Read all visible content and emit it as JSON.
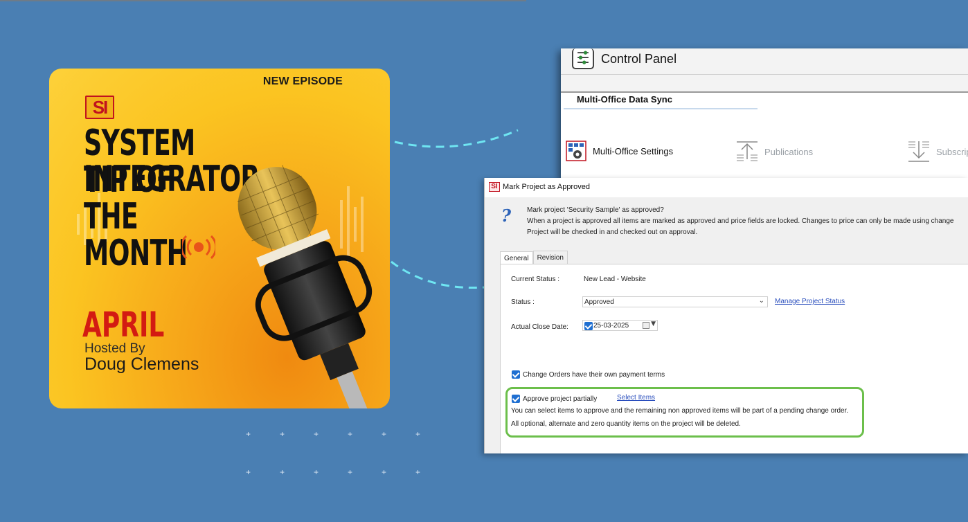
{
  "podcast": {
    "badge": "NEW EPISODE",
    "logo": "SI",
    "title_lines": [
      "SYSTEM INTEGRATOR",
      "TIP OF",
      "THE",
      "MONTH"
    ],
    "month": "APRIL",
    "hosted_by": "Hosted By",
    "host": "Doug Clemens",
    "icons": [
      "broadcast-icon",
      "microphone-image"
    ]
  },
  "control_panel": {
    "title": "Control Panel",
    "tab": "Multi-Office Data Sync",
    "items": [
      {
        "label": "Multi-Office Settings",
        "icon": "settings-grid-icon",
        "state": "active"
      },
      {
        "label": "Publications",
        "icon": "upload-icon",
        "state": "disabled"
      },
      {
        "label": "Subscrip",
        "icon": "download-icon",
        "state": "disabled"
      }
    ]
  },
  "dialog": {
    "title": "Mark Project as Approved",
    "message": [
      "Mark project 'Security Sample' as approved?",
      "When a project is approved all items are marked as approved and price fields are locked. Changes to price can only be made using change",
      "Project will be checked in and checked out on approval."
    ],
    "tabs": [
      "General",
      "Revision"
    ],
    "active_tab": "General",
    "fields": {
      "current_status_label": "Current Status :",
      "current_status_value": "New Lead - Website",
      "status_label": "Status :",
      "status_value": "Approved",
      "manage_link": "Manage Project Status",
      "close_date_label": "Actual Close Date:",
      "close_date_value": "25-03-2025"
    },
    "change_orders": {
      "label": "Change Orders have their own payment terms",
      "checked": true
    },
    "approve_partially": {
      "label": "Approve project partially",
      "checked": true,
      "link": "Select Items",
      "note1": "You can select items to approve and the remaining non approved items will be part of a pending change order.",
      "note2": "All optional, alternate and zero quantity items on the project will be deleted."
    }
  },
  "colors": {
    "background": "#4a7fb3",
    "highlight": "#6cbf4b",
    "accent_red": "#d31b12",
    "checkbox": "#1f6fd1"
  }
}
